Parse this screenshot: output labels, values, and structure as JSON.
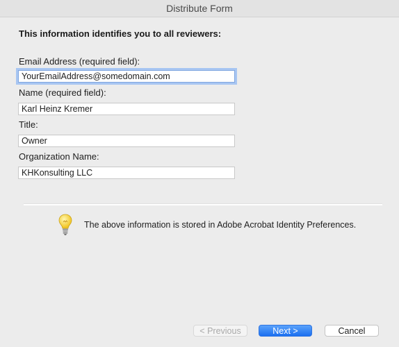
{
  "window": {
    "title": "Distribute Form"
  },
  "form": {
    "heading": "This information identifies you to all reviewers:",
    "email": {
      "label": "Email Address (required field):",
      "value": "YourEmailAddress@somedomain.com"
    },
    "name": {
      "label": "Name (required field):",
      "value": "Karl Heinz Kremer"
    },
    "title": {
      "label": "Title:",
      "value": "Owner"
    },
    "organization": {
      "label": "Organization Name:",
      "value": "KHKonsulting LLC"
    }
  },
  "info": {
    "icon": "lightbulb-icon",
    "text": "The above information is stored in Adobe Acrobat Identity Preferences."
  },
  "buttons": {
    "previous": "< Previous",
    "next": "Next >",
    "cancel": "Cancel"
  },
  "colors": {
    "primary_button": "#1b6ff0",
    "focus_ring": "#a8c6f2"
  }
}
